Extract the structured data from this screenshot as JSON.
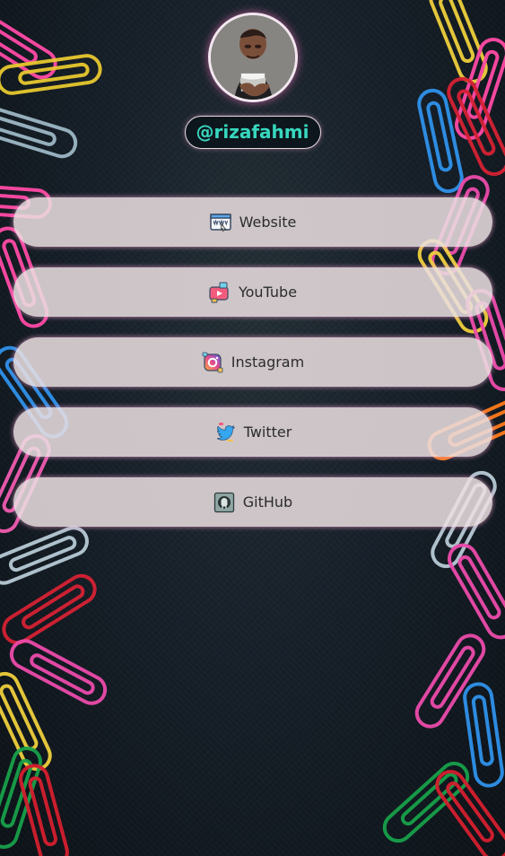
{
  "profile": {
    "handle": "@rizafahmi"
  },
  "links": [
    {
      "label": "Website",
      "icon": "website-icon"
    },
    {
      "label": "YouTube",
      "icon": "youtube-icon"
    },
    {
      "label": "Instagram",
      "icon": "instagram-icon"
    },
    {
      "label": "Twitter",
      "icon": "twitter-icon"
    },
    {
      "label": "GitHub",
      "icon": "github-icon"
    }
  ],
  "colors": {
    "handle_text": "#37d7be",
    "link_background": "#ebe0e2",
    "glow": "#ff8fd0"
  }
}
